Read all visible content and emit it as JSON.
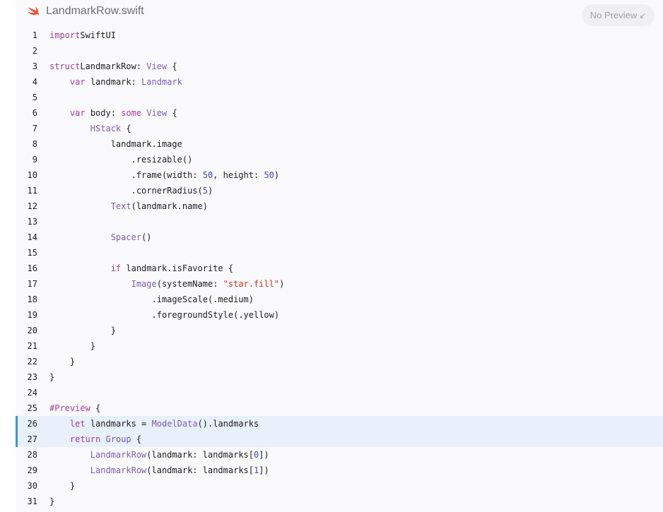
{
  "header": {
    "filename": "LandmarkRow.swift",
    "icon": "swift-logo-icon",
    "preview_button": "No Preview",
    "preview_icon": "↙",
    "accent_color": "#f05138"
  },
  "code": {
    "highlighted_lines": [
      26,
      27
    ],
    "lines": [
      {
        "n": "1",
        "tokens": [
          [
            "kw",
            "import"
          ],
          [
            "",
            "SwiftUI"
          ]
        ]
      },
      {
        "n": "2",
        "tokens": []
      },
      {
        "n": "3",
        "tokens": [
          [
            "kw",
            "struct"
          ],
          [
            "",
            "LandmarkRow"
          ],
          [
            "",
            ": "
          ],
          [
            "ty",
            "View"
          ],
          [
            "",
            " {"
          ]
        ]
      },
      {
        "n": "4",
        "tokens": [
          [
            "",
            "    "
          ],
          [
            "kw",
            "var"
          ],
          [
            "",
            " landmark: "
          ],
          [
            "ty",
            "Landmark"
          ]
        ]
      },
      {
        "n": "5",
        "tokens": []
      },
      {
        "n": "6",
        "tokens": [
          [
            "",
            "    "
          ],
          [
            "kw",
            "var"
          ],
          [
            "",
            " body: "
          ],
          [
            "kw",
            "some"
          ],
          [
            "",
            " "
          ],
          [
            "ty",
            "View"
          ],
          [
            "",
            " {"
          ]
        ]
      },
      {
        "n": "7",
        "tokens": [
          [
            "",
            "        "
          ],
          [
            "ty",
            "HStack"
          ],
          [
            "",
            " {"
          ]
        ]
      },
      {
        "n": "8",
        "tokens": [
          [
            "",
            "            landmark.image"
          ]
        ]
      },
      {
        "n": "9",
        "tokens": [
          [
            "",
            "                .resizable()"
          ]
        ]
      },
      {
        "n": "10",
        "tokens": [
          [
            "",
            "                .frame(width: "
          ],
          [
            "nu",
            "50"
          ],
          [
            "",
            ", height: "
          ],
          [
            "nu",
            "50"
          ],
          [
            "",
            ")"
          ]
        ]
      },
      {
        "n": "11",
        "tokens": [
          [
            "",
            "                .cornerRadius("
          ],
          [
            "nu",
            "5"
          ],
          [
            "",
            ")"
          ]
        ]
      },
      {
        "n": "12",
        "tokens": [
          [
            "",
            "            "
          ],
          [
            "ty",
            "Text"
          ],
          [
            "",
            "(landmark.name)"
          ]
        ]
      },
      {
        "n": "13",
        "tokens": []
      },
      {
        "n": "14",
        "tokens": [
          [
            "",
            "            "
          ],
          [
            "ty",
            "Spacer"
          ],
          [
            "",
            "()"
          ]
        ]
      },
      {
        "n": "15",
        "tokens": []
      },
      {
        "n": "16",
        "tokens": [
          [
            "",
            "            "
          ],
          [
            "kw",
            "if"
          ],
          [
            "",
            " landmark.isFavorite {"
          ]
        ]
      },
      {
        "n": "17",
        "tokens": [
          [
            "",
            "                "
          ],
          [
            "ty",
            "Image"
          ],
          [
            "",
            "(systemName: "
          ],
          [
            "st",
            "\"star.fill\""
          ],
          [
            "",
            ")"
          ]
        ]
      },
      {
        "n": "18",
        "tokens": [
          [
            "",
            "                    .imageScale(.medium)"
          ]
        ]
      },
      {
        "n": "19",
        "tokens": [
          [
            "",
            "                    .foregroundStyle(.yellow)"
          ]
        ]
      },
      {
        "n": "20",
        "tokens": [
          [
            "",
            "            }"
          ]
        ]
      },
      {
        "n": "21",
        "tokens": [
          [
            "",
            "        }"
          ]
        ]
      },
      {
        "n": "22",
        "tokens": [
          [
            "",
            "    }"
          ]
        ]
      },
      {
        "n": "23",
        "tokens": [
          [
            "",
            "}"
          ]
        ]
      },
      {
        "n": "24",
        "tokens": []
      },
      {
        "n": "25",
        "tokens": [
          [
            "kw",
            "#Preview"
          ],
          [
            "",
            " {"
          ]
        ]
      },
      {
        "n": "26",
        "tokens": [
          [
            "",
            "    "
          ],
          [
            "kw",
            "let"
          ],
          [
            "",
            " landmarks = "
          ],
          [
            "ty",
            "ModelData"
          ],
          [
            "",
            "().landmarks"
          ]
        ]
      },
      {
        "n": "27",
        "tokens": [
          [
            "",
            "    "
          ],
          [
            "kw",
            "return"
          ],
          [
            "",
            " "
          ],
          [
            "ty",
            "Group"
          ],
          [
            "",
            " {"
          ]
        ]
      },
      {
        "n": "28",
        "tokens": [
          [
            "",
            "        "
          ],
          [
            "ty",
            "LandmarkRow"
          ],
          [
            "",
            "(landmark: landmarks["
          ],
          [
            "nu",
            "0"
          ],
          [
            "",
            "])"
          ]
        ]
      },
      {
        "n": "29",
        "tokens": [
          [
            "",
            "        "
          ],
          [
            "ty",
            "LandmarkRow"
          ],
          [
            "",
            "(landmark: landmarks["
          ],
          [
            "nu",
            "1"
          ],
          [
            "",
            "])"
          ]
        ]
      },
      {
        "n": "30",
        "tokens": [
          [
            "",
            "    }"
          ]
        ]
      },
      {
        "n": "31",
        "tokens": [
          [
            "",
            "}"
          ]
        ]
      }
    ]
  }
}
